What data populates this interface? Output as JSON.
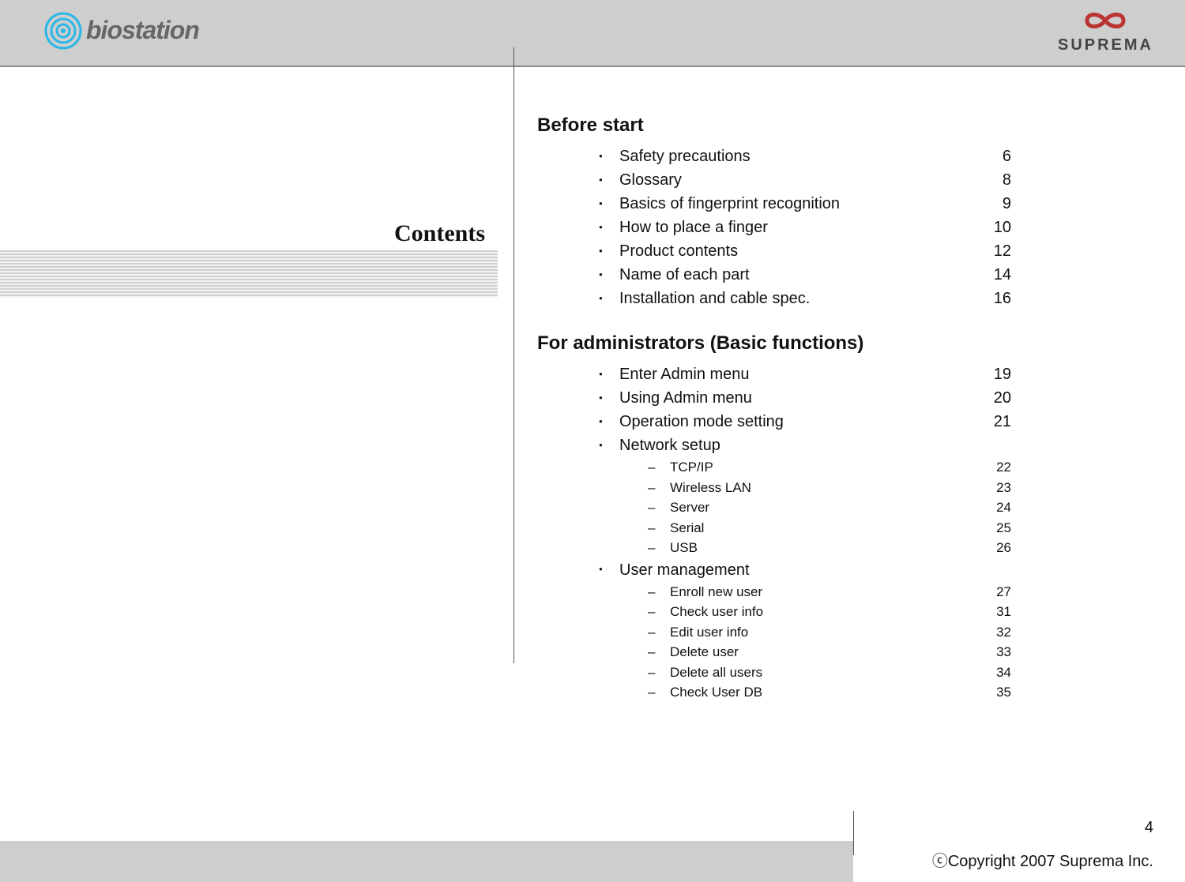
{
  "header": {
    "logoLeftText": "biostation",
    "logoRightText": "SUPREMA"
  },
  "contentsTitle": "Contents",
  "sections": [
    {
      "title": "Before start",
      "items": [
        {
          "label": "Safety precautions",
          "page": "6"
        },
        {
          "label": "Glossary",
          "page": "8"
        },
        {
          "label": "Basics of fingerprint recognition",
          "page": "9"
        },
        {
          "label": "How to place a finger",
          "page": "10"
        },
        {
          "label": "Product contents",
          "page": "12"
        },
        {
          "label": "Name of each part",
          "page": "14"
        },
        {
          "label": "Installation and cable spec.",
          "page": "16"
        }
      ]
    },
    {
      "title": "For administrators (Basic functions)",
      "items": [
        {
          "label": "Enter Admin menu",
          "page": "19"
        },
        {
          "label": "Using Admin menu",
          "page": "20"
        },
        {
          "label": "Operation mode setting",
          "page": "21"
        },
        {
          "label": "Network setup",
          "page": "",
          "sub": [
            {
              "label": "TCP/IP",
              "page": "22"
            },
            {
              "label": "Wireless LAN",
              "page": "23"
            },
            {
              "label": "Server",
              "page": "24"
            },
            {
              "label": "Serial",
              "page": "25"
            },
            {
              "label": "USB",
              "page": "26"
            }
          ]
        },
        {
          "label": "User management",
          "page": "",
          "sub": [
            {
              "label": "Enroll new user",
              "page": "27"
            },
            {
              "label": "Check user info",
              "page": "31"
            },
            {
              "label": "Edit user info",
              "page": "32"
            },
            {
              "label": "Delete user",
              "page": "33"
            },
            {
              "label": "Delete all users",
              "page": "34"
            },
            {
              "label": "Check User DB",
              "page": "35"
            }
          ]
        }
      ]
    }
  ],
  "footer": {
    "pageNumber": "4",
    "copyright": "ⓒCopyright 2007 Suprema Inc."
  }
}
